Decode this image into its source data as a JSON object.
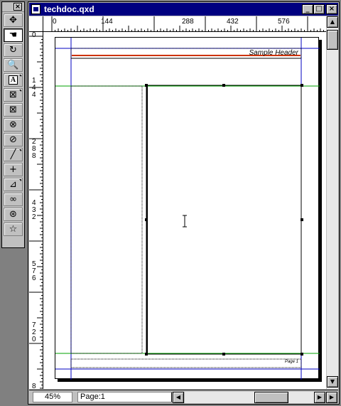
{
  "window": {
    "title": "techdoc.qxd"
  },
  "palette": {
    "close_label": "×",
    "tools": [
      {
        "name": "item-tool",
        "glyph": "✥"
      },
      {
        "name": "content-tool",
        "glyph": "☚",
        "active": true
      },
      {
        "name": "rotation-tool",
        "glyph": "↻"
      },
      {
        "name": "zoom-tool",
        "glyph": "🔍"
      },
      {
        "name": "text-box-tool",
        "glyph": "A"
      },
      {
        "name": "rectangle-picture-box-tool",
        "glyph": "⊠"
      },
      {
        "name": "rounded-picture-box-tool",
        "glyph": "⊠"
      },
      {
        "name": "oval-picture-box-tool",
        "glyph": "⊗"
      },
      {
        "name": "bezier-picture-box-tool",
        "glyph": "⊘"
      },
      {
        "name": "line-tool",
        "glyph": "╱"
      },
      {
        "name": "orthogonal-line-tool",
        "glyph": "+"
      },
      {
        "name": "bezier-line-tool",
        "glyph": "⊿"
      },
      {
        "name": "linking-tool",
        "glyph": "∞"
      },
      {
        "name": "unlinking-tool",
        "glyph": "⊛"
      },
      {
        "name": "star-tool",
        "glyph": "☆"
      }
    ]
  },
  "ruler": {
    "h_labels": [
      "144",
      "288",
      "432",
      "576"
    ],
    "h_zero": "0",
    "v_labels": [
      {
        "chars": [
          "0"
        ]
      },
      {
        "chars": [
          "1",
          "4",
          "4"
        ]
      },
      {
        "chars": [
          "2",
          "8",
          "8"
        ]
      },
      {
        "chars": [
          "4",
          "3",
          "2"
        ]
      },
      {
        "chars": [
          "5",
          "7",
          "6"
        ]
      },
      {
        "chars": [
          "7",
          "2",
          "0"
        ]
      },
      {
        "chars": [
          "8"
        ]
      }
    ]
  },
  "document": {
    "header_text": "Sample Header",
    "footer_text": "Page 1"
  },
  "status": {
    "zoom": "45%",
    "page_label": "Page:",
    "page_value": "1"
  },
  "colors": {
    "margin_guide": "#0000c0",
    "column_guide": "#00a000",
    "header_rule": "#cc3300"
  }
}
